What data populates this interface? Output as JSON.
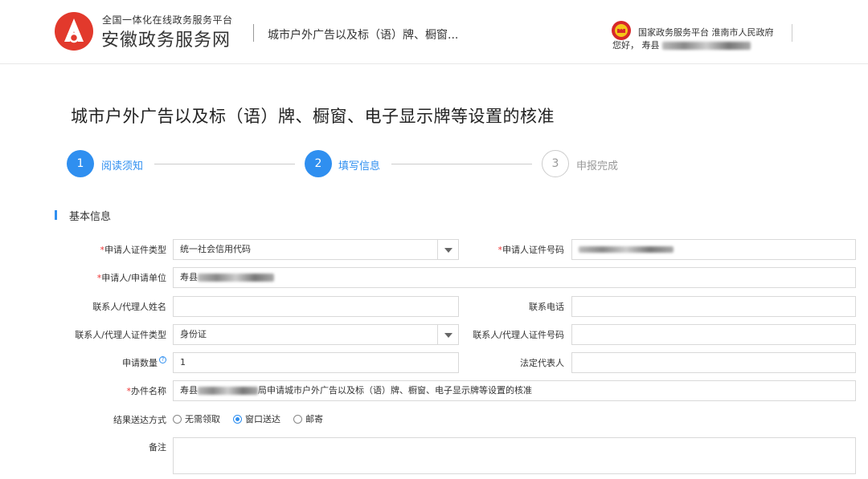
{
  "header": {
    "brand_small": "全国一体化在线政务服务平台",
    "brand_big": "安徽政务服务网",
    "service_title": "城市户外广告以及标（语）牌、橱窗...",
    "link_national": "国家政务服务平台",
    "link_city": "淮南市人民政府",
    "greeting": "您好，",
    "user_prefix": "寿县"
  },
  "page": {
    "title": "城市户外广告以及标（语）牌、橱窗、电子显示牌等设置的核准"
  },
  "steps": [
    {
      "num": "1",
      "label": "阅读须知",
      "state": "active"
    },
    {
      "num": "2",
      "label": "填写信息",
      "state": "active"
    },
    {
      "num": "3",
      "label": "申报完成",
      "state": "inactive"
    }
  ],
  "section": {
    "title": "基本信息"
  },
  "form": {
    "applicant_id_type_label": "申请人证件类型",
    "applicant_id_type_value": "统一社会信用代码",
    "applicant_id_no_label": "申请人证件号码",
    "applicant_unit_label": "申请人/申请单位",
    "applicant_unit_prefix": "寿县",
    "contact_name_label": "联系人/代理人姓名",
    "contact_name_value": "",
    "contact_phone_label": "联系电话",
    "contact_phone_value": "",
    "contact_id_type_label": "联系人/代理人证件类型",
    "contact_id_type_value": "身份证",
    "contact_id_no_label": "联系人/代理人证件号码",
    "contact_id_no_value": "",
    "quantity_label": "申请数量",
    "quantity_value": "1",
    "legal_rep_label": "法定代表人",
    "legal_rep_value": "",
    "case_name_label": "办件名称",
    "case_name_prefix": "寿县",
    "case_name_suffix": "局申请城市户外广告以及标（语）牌、橱窗、电子显示牌等设置的核准",
    "delivery_label": "结果送达方式",
    "delivery_options": [
      "无需领取",
      "窗口送达",
      "邮寄"
    ],
    "delivery_selected": "窗口送达",
    "remarks_label": "备注",
    "required_mark": "*"
  },
  "colors": {
    "accent": "#2f8ff0",
    "required": "#ee3333",
    "logo": "#e2392c"
  }
}
